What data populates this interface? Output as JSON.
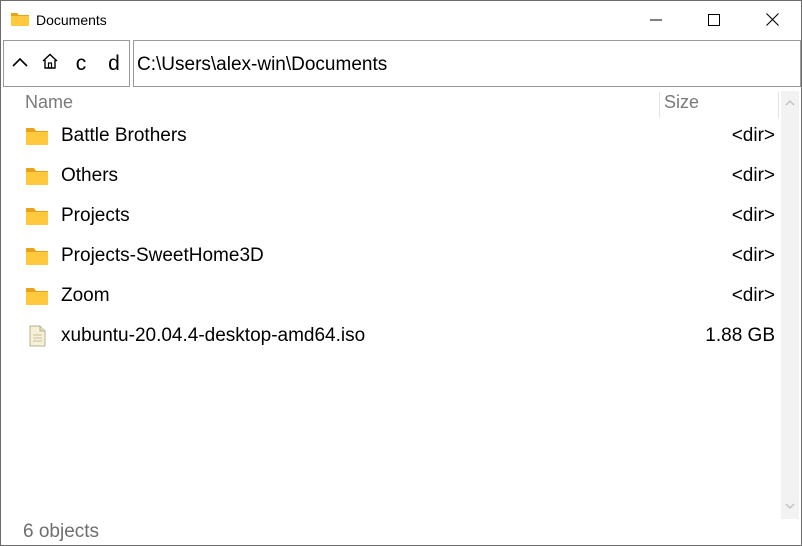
{
  "window": {
    "title": "Documents",
    "icon": "folder-icon",
    "controls": [
      "minimize-icon",
      "maximize-icon",
      "close-icon"
    ]
  },
  "toolbar": {
    "up_icon": "chevron-up-icon",
    "home_icon": "home-icon",
    "drive_c": "c",
    "drive_d": "d",
    "path": "C:\\Users\\alex-win\\Documents"
  },
  "columns": {
    "name": "Name",
    "size": "Size"
  },
  "items": [
    {
      "name": "Battle Brothers",
      "size": "<dir>",
      "type": "folder"
    },
    {
      "name": "Others",
      "size": "<dir>",
      "type": "folder"
    },
    {
      "name": "Projects",
      "size": "<dir>",
      "type": "folder"
    },
    {
      "name": "Projects-SweetHome3D",
      "size": "<dir>",
      "type": "folder"
    },
    {
      "name": "Zoom",
      "size": "<dir>",
      "type": "folder"
    },
    {
      "name": "xubuntu-20.04.4-desktop-amd64.iso",
      "size": "1.88 GB",
      "type": "file"
    }
  ],
  "status": {
    "text": "6 objects"
  },
  "colors": {
    "folder_yellow": "#FFC83D",
    "folder_dark": "#E8A317",
    "file_paper": "#F5F0D8"
  }
}
